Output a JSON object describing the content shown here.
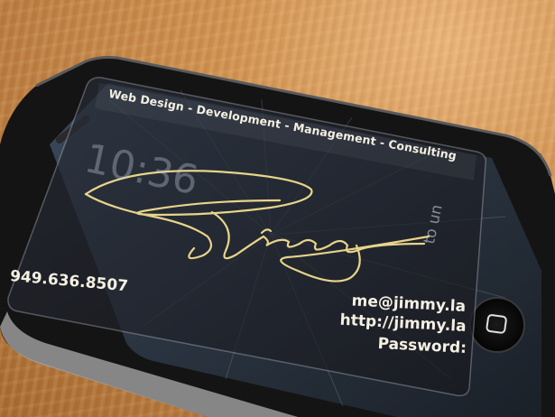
{
  "business_card": {
    "tagline": "Web Design - Development - Management - Consulting",
    "phone": "949.636.8507",
    "email": "me@jimmy.la",
    "website": "http://jimmy.la",
    "password_label": "Password:"
  },
  "phone_screen": {
    "lock_time": "10:36",
    "slide_hint": "to un"
  },
  "colors": {
    "table": "#c98a4a",
    "card_text": "#f4f0e2",
    "signature_gold": "#e8d48a",
    "phone_body": "#141414"
  }
}
